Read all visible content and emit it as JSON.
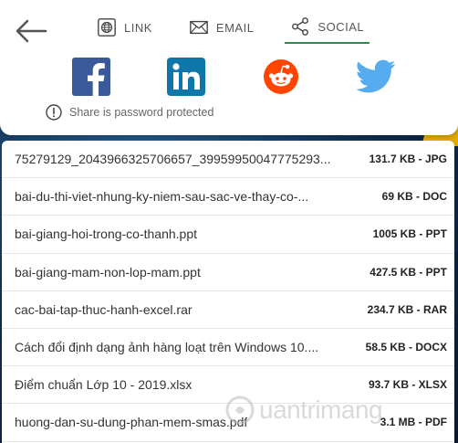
{
  "tabs": [
    {
      "label": "LINK",
      "icon": "globe-icon"
    },
    {
      "label": "EMAIL",
      "icon": "envelope-icon"
    },
    {
      "label": "SOCIAL",
      "icon": "share-icon",
      "active": true
    }
  ],
  "social": [
    "facebook",
    "linkedin",
    "reddit",
    "twitter"
  ],
  "colors": {
    "facebook": "#3b5998",
    "linkedin": "#0e76a8",
    "reddit": "#ff4500",
    "twitter": "#55acee",
    "active_tab": "#2e8b57"
  },
  "notice": "Share is password protected",
  "files": [
    {
      "name": "75279129_2043966325706657_39959950047775293...",
      "size": "131.7 KB - JPG"
    },
    {
      "name": "bai-du-thi-viet-nhung-ky-niem-sau-sac-ve-thay-co-...",
      "size": "69 KB - DOC"
    },
    {
      "name": "bai-giang-hoi-trong-co-thanh.ppt",
      "size": "1005 KB - PPT"
    },
    {
      "name": "bai-giang-mam-non-lop-mam.ppt",
      "size": "427.5 KB - PPT"
    },
    {
      "name": "cac-bai-tap-thuc-hanh-excel.rar",
      "size": "234.7 KB - RAR"
    },
    {
      "name": "Cách đổi định dạng ảnh hàng loạt trên Windows 10....",
      "size": "58.5 KB - DOCX"
    },
    {
      "name": "Điểm chuẩn Lớp 10 - 2019.xlsx",
      "size": "93.7 KB - XLSX"
    },
    {
      "name": "huong-dan-su-dung-phan-mem-smas.pdf",
      "size": "3.1 MB - PDF"
    }
  ],
  "watermark": "uantrimang"
}
